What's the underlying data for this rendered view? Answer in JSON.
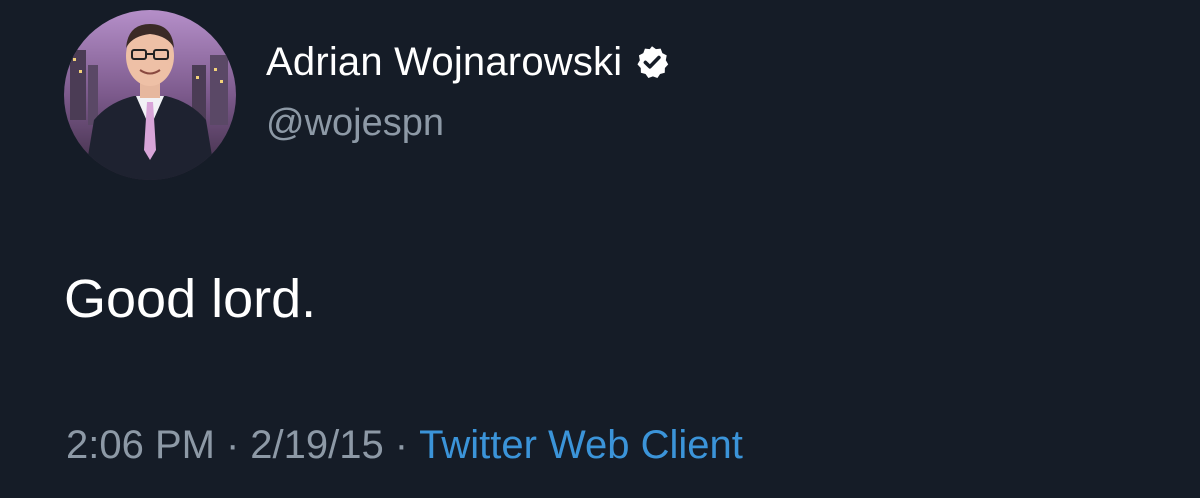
{
  "author": {
    "display_name": "Adrian Wojnarowski",
    "handle": "@wojespn",
    "verified": true,
    "avatar_icon": "profile-photo"
  },
  "tweet": {
    "text": "Good lord."
  },
  "meta": {
    "time": "2:06 PM",
    "separator": "·",
    "date": "2/19/15",
    "source": "Twitter Web Client"
  },
  "colors": {
    "background": "#151c27",
    "text": "#ffffff",
    "muted": "#8d99a6",
    "link": "#3b94d9"
  }
}
